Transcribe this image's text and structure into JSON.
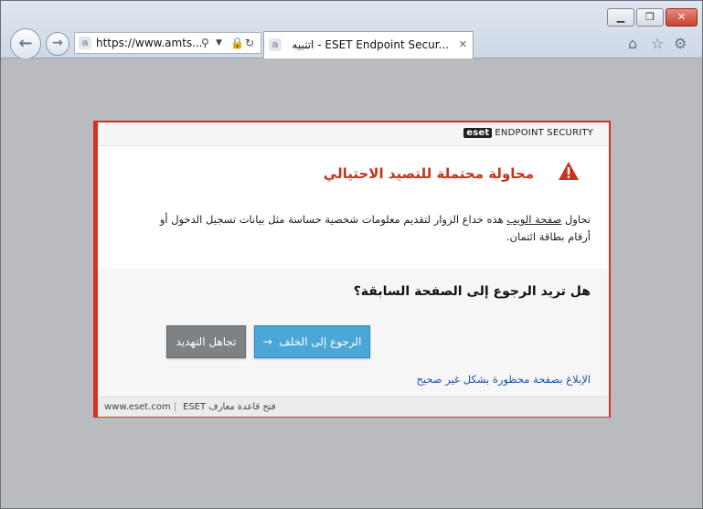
{
  "browser": {
    "address": "https://www.amts...",
    "tab_title": "اتنبيه - ESET Endpoint Secur...",
    "tab_close": "✕",
    "window_min": "▁",
    "window_max": "❐",
    "window_close": "✕"
  },
  "icons": {
    "back": "back-arrow-icon",
    "forward": "forward-arrow-icon",
    "search": "search-icon",
    "lock": "lock-icon",
    "refresh": "refresh-icon",
    "home": "home-icon",
    "favorites": "star-icon",
    "settings": "gear-icon",
    "warning": "warning-triangle-icon"
  },
  "eset": {
    "logo_mark": "eset",
    "product": "ENDPOINT SECURITY",
    "alert_title": "محاولة محتملة للتصيد الاحتيالي",
    "desc_prefix": "تحاول ",
    "desc_link": "صفحة الويب",
    "desc_rest": " هذه خداع الزوار لتقديم معلومات شخصية حساسة مثل بيانات تسجيل الدخول أو أرقام بطاقة ائتمان.",
    "question": "هل تريد الرجوع إلى الصفحة السابقة؟",
    "back_button": "الرجوع إلى الخلف",
    "back_arrow": "→",
    "ignore_button": "تجاهل التهديد",
    "report_link": "الإبلاغ بصفحة محظورة بشكل غير صحيح",
    "footer_site": "www.eset.com",
    "footer_sep": "|",
    "footer_kb": "فتح قاعدة معارف ESET"
  },
  "colors": {
    "accent_red": "#d6321f",
    "button_blue": "#4aa7d8",
    "button_grey": "#7f8285",
    "link_blue": "#1a55a6"
  }
}
